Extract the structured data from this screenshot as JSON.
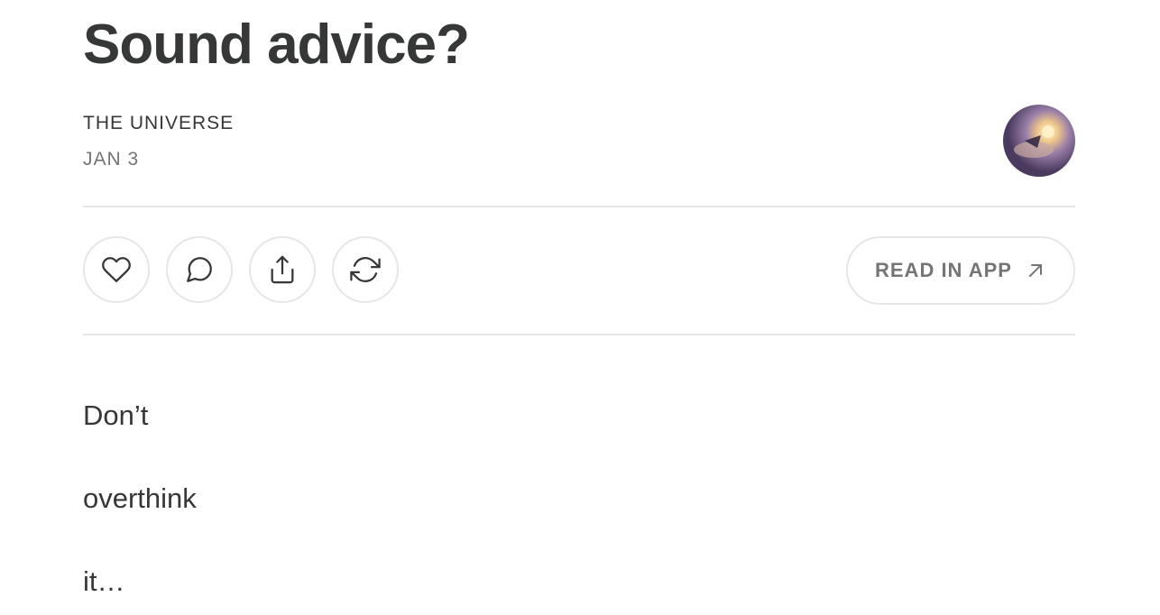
{
  "post": {
    "title": "Sound advice?",
    "author": "THE UNIVERSE",
    "date": "JAN 3"
  },
  "avatar": {
    "icon": "author-avatar",
    "colors": [
      "#3a2e4a",
      "#7a6a8c",
      "#f4d9a8"
    ]
  },
  "actions": {
    "like_icon": "heart-icon",
    "comment_icon": "comment-bubble-icon",
    "share_icon": "share-icon",
    "restack_icon": "restack-icon",
    "read_in_app_label": "READ IN APP",
    "read_in_app_icon": "arrow-up-right-icon"
  },
  "body": {
    "lines": [
      "Don’t",
      "overthink",
      "it…"
    ]
  },
  "colors": {
    "text": "#363737",
    "muted": "#757575",
    "border": "#e6e6e6",
    "background": "#ffffff"
  }
}
